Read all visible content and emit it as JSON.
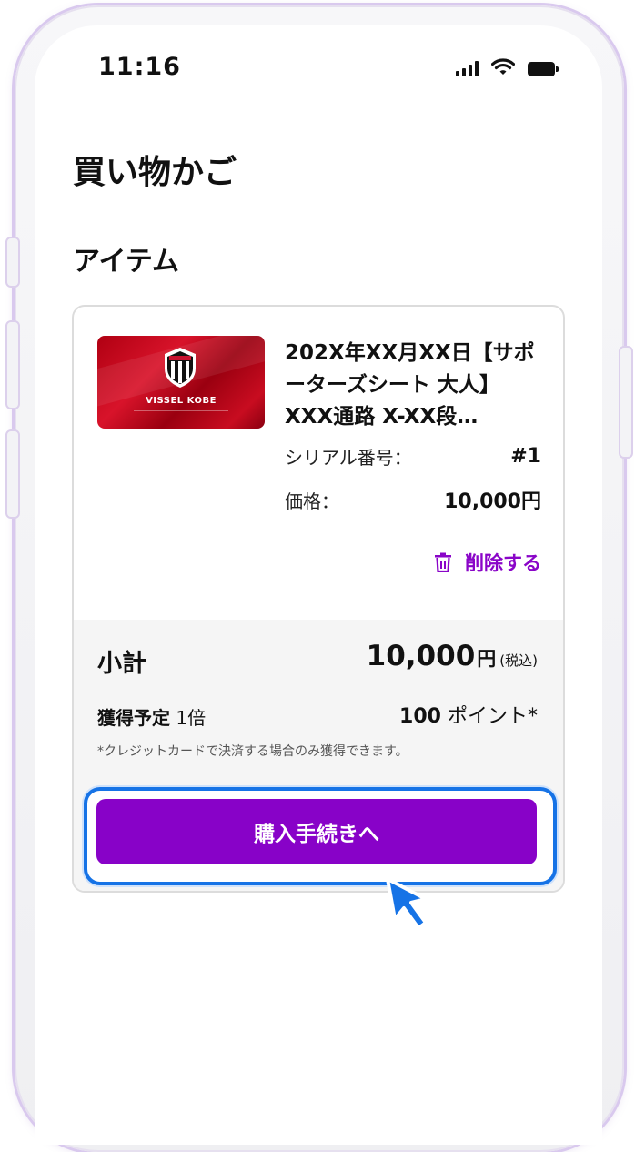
{
  "status_bar": {
    "time": "11:16",
    "icons": [
      "signal-icon",
      "wifi-icon",
      "battery-icon"
    ]
  },
  "page": {
    "title": "買い物かご",
    "section_title": "アイテム"
  },
  "item": {
    "image_brand": "VISSEL KOBE",
    "title": "202X年XX月XX日【サポーターズシート 大人】XXX通路 X-XX段…",
    "serial_label": "シリアル番号：",
    "serial_value": "#1",
    "price_label": "価格：",
    "price_value": "10,000円",
    "delete_label": "削除する"
  },
  "summary": {
    "subtotal_label": "小計",
    "subtotal_amount": "10,000",
    "subtotal_currency": "円",
    "subtotal_tax_note": "(税込)",
    "points_label": "獲得予定",
    "points_multiplier": "1倍",
    "points_amount": "100",
    "points_unit": "ポイント*",
    "note": "*クレジットカードで決済する場合のみ獲得できます。"
  },
  "checkout_button": {
    "label": "購入手続きへ"
  },
  "colors": {
    "accent": "#8802c8",
    "highlight": "#1673e6",
    "brand_red": "#c8102e"
  }
}
